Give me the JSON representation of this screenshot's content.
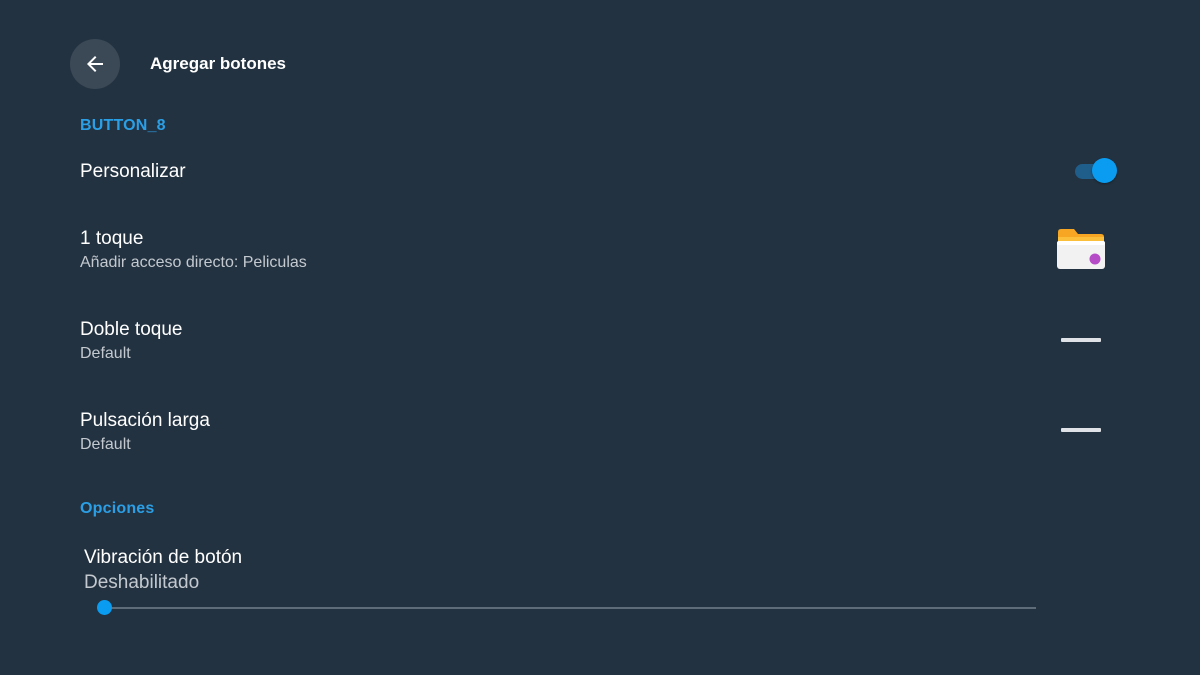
{
  "header": {
    "title": "Agregar botones",
    "back_icon": "arrow-left-icon"
  },
  "sections": {
    "button_header": "BUTTON_8",
    "options_header": "Opciones"
  },
  "settings": {
    "personalize": {
      "title": "Personalizar",
      "enabled": true
    },
    "single_tap": {
      "title": "1 toque",
      "subtitle": "Añadir acceso directo: Peliculas",
      "icon": "folder-icon"
    },
    "double_tap": {
      "title": "Doble toque",
      "subtitle": "Default",
      "icon": "dash-icon"
    },
    "long_press": {
      "title": "Pulsación larga",
      "subtitle": "Default",
      "icon": "dash-icon"
    }
  },
  "vibration": {
    "title": "Vibración de botón",
    "subtitle": "Deshabilitado",
    "level": 0
  },
  "colors": {
    "background": "#233241",
    "accent": "#0a9cf0",
    "section_header": "#2b9fe6"
  }
}
